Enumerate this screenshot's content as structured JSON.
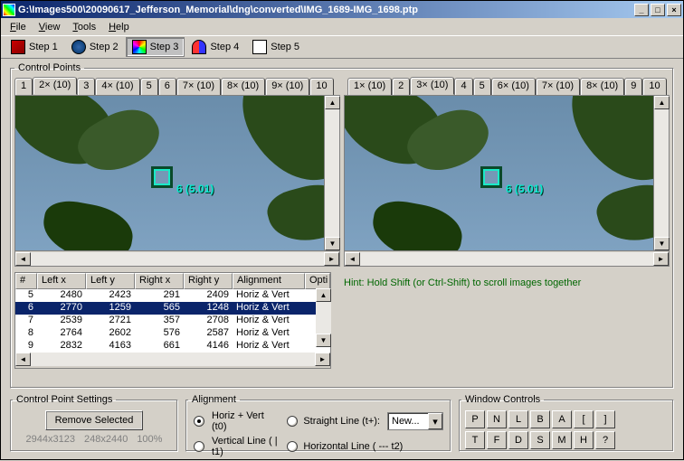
{
  "window": {
    "title": "G:\\Images500\\20090617_Jefferson_Memorial\\dng\\converted\\IMG_1689-IMG_1698.ptp"
  },
  "menus": {
    "file": "File",
    "view": "View",
    "tools": "Tools",
    "help": "Help"
  },
  "steps": {
    "s1": "Step 1",
    "s2": "Step 2",
    "s3": "Step 3",
    "s4": "Step 4",
    "s5": "Step 5"
  },
  "cp_legend": "Control Points",
  "left_tabs": [
    "1",
    "2× (10)",
    "3",
    "4× (10)",
    "5",
    "6",
    "7× (10)",
    "8× (10)",
    "9× (10)",
    "10"
  ],
  "left_active": 1,
  "right_tabs": [
    "1× (10)",
    "2",
    "3× (10)",
    "4",
    "5",
    "6× (10)",
    "7× (10)",
    "8× (10)",
    "9",
    "10"
  ],
  "right_active": 2,
  "marker_label": "6 (5.01)",
  "table": {
    "headers": {
      "num": "#",
      "lx": "Left x",
      "ly": "Left y",
      "rx": "Right x",
      "ry": "Right y",
      "align": "Alignment",
      "opt": "Opti"
    },
    "rows": [
      {
        "n": "5",
        "lx": "2480",
        "ly": "2423",
        "rx": "291",
        "ry": "2409",
        "a": "Horiz & Vert"
      },
      {
        "n": "6",
        "lx": "2770",
        "ly": "1259",
        "rx": "565",
        "ry": "1248",
        "a": "Horiz & Vert",
        "sel": true
      },
      {
        "n": "7",
        "lx": "2539",
        "ly": "2721",
        "rx": "357",
        "ry": "2708",
        "a": "Horiz & Vert"
      },
      {
        "n": "8",
        "lx": "2764",
        "ly": "2602",
        "rx": "576",
        "ry": "2587",
        "a": "Horiz & Vert"
      },
      {
        "n": "9",
        "lx": "2832",
        "ly": "4163",
        "rx": "661",
        "ry": "4146",
        "a": "Horiz & Vert"
      }
    ]
  },
  "hint": "Hint: Hold Shift (or Ctrl-Shift) to scroll images together",
  "cps": {
    "legend": "Control Point Settings",
    "remove": "Remove Selected",
    "dim1": "2944x3123",
    "dim2": "248x2440",
    "zoom": "100%"
  },
  "align": {
    "legend": "Alignment",
    "hv": "Horiz + Vert (t0)",
    "sl": "Straight Line (t+):",
    "vl": "Vertical Line ( | t1)",
    "hl": "Horizontal Line ( --- t2)",
    "combo": "New..."
  },
  "wc": {
    "legend": "Window Controls",
    "row1": [
      "P",
      "N",
      "L",
      "B",
      "A",
      "[",
      "]"
    ],
    "row2": [
      "T",
      "F",
      "D",
      "S",
      "M",
      "H",
      "?"
    ]
  }
}
